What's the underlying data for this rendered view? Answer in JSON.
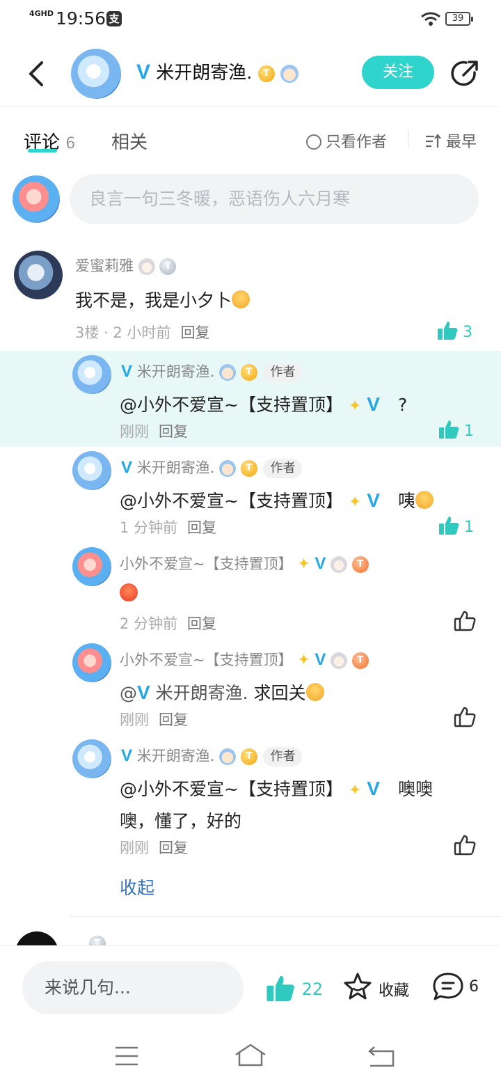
{
  "status_bar": {
    "network": "4GHD",
    "time": "19:56",
    "battery": "39"
  },
  "header": {
    "username": "米开朗寄渔.",
    "follow_label": "关注"
  },
  "tabs": {
    "comments_label": "评论",
    "comments_count": "6",
    "related_label": "相关",
    "only_author_label": "只看作者",
    "sort_label": "最早"
  },
  "comment_input": {
    "placeholder": "良言一句三冬暖，恶语伤人六月寒"
  },
  "main_comment": {
    "username": "爱蜜莉雅",
    "text": "我不是，我是小夕卜",
    "floor": "3楼 · 2 小时前",
    "reply_label": "回复",
    "likes": "3"
  },
  "replies": [
    {
      "username": "米开朗寄渔.",
      "author_tag": "作者",
      "mention": "@小外不爱宣~【支持置顶】",
      "text": "?",
      "time": "刚刚",
      "reply_label": "回复",
      "likes": "1"
    },
    {
      "username": "米开朗寄渔.",
      "author_tag": "作者",
      "mention": "@小外不爱宣~【支持置顶】",
      "text": "咦",
      "time": "1 分钟前",
      "reply_label": "回复",
      "likes": "1"
    },
    {
      "username": "小外不爱宣~【支持置顶】",
      "text": "",
      "time": "2 分钟前",
      "reply_label": "回复"
    },
    {
      "username": "小外不爱宣~【支持置顶】",
      "mention": "@",
      "mention_name": "米开朗寄渔.",
      "text": "求回关",
      "time": "刚刚",
      "reply_label": "回复"
    },
    {
      "username": "米开朗寄渔.",
      "author_tag": "作者",
      "mention": "@小外不爱宣~【支持置顶】",
      "text": "噢噢",
      "text_line2": "噢，懂了，好的",
      "time": "刚刚",
      "reply_label": "回复"
    }
  ],
  "collapse_label": "收起",
  "bottom_bar": {
    "input_placeholder": "来说几句...",
    "likes": "22",
    "collect_label": "收藏",
    "comment_count": "6"
  },
  "icons": {
    "back": "chevron-left-icon",
    "share": "share-icon",
    "thumb": "thumbs-up-icon",
    "star": "star-icon",
    "comment": "comment-bubble-icon"
  },
  "colors": {
    "accent": "#2fd5cc",
    "like": "#2fc9c0",
    "verified": "#22a7e8",
    "link": "#3672b5",
    "highlight": "#e7f8f7"
  }
}
